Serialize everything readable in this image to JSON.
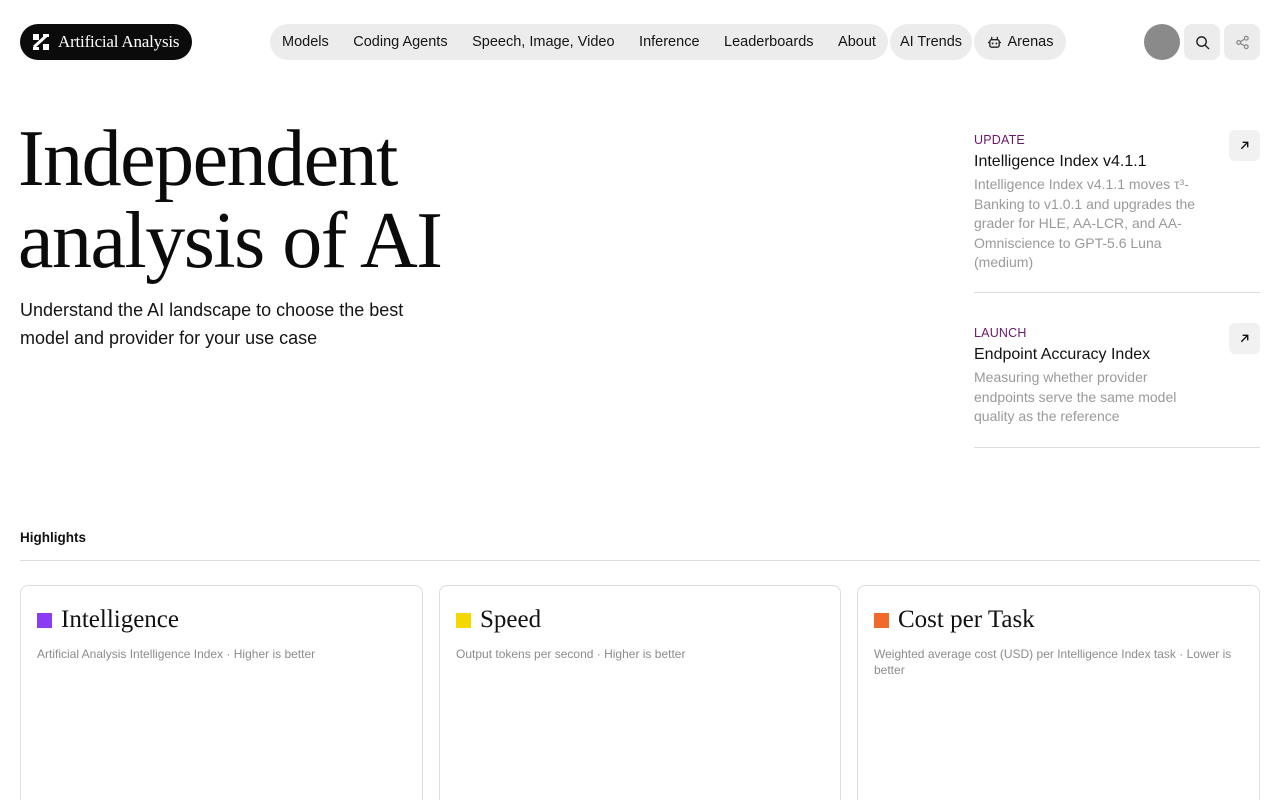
{
  "brand": {
    "name": "Artificial Analysis"
  },
  "nav": {
    "items": [
      "Models",
      "Coding Agents",
      "Speech, Image, Video",
      "Inference",
      "Leaderboards",
      "About"
    ],
    "trends": "AI Trends",
    "arenas": "Arenas"
  },
  "icons": {
    "search": "search-icon",
    "share": "share-icon",
    "arenas": "arena-icon",
    "arrow": "arrow-up-right-icon"
  },
  "hero": {
    "title_line1": "Independent",
    "title_line2": "analysis of AI",
    "subtitle": "Understand the AI landscape to choose the best model and provider for your use case"
  },
  "news": [
    {
      "tag": "UPDATE",
      "title": "Intelligence Index v4.1.1",
      "desc": "Intelligence Index v4.1.1 moves τ³-Banking to v1.0.1 and upgrades the grader for HLE, AA-LCR, and AA-Omniscience to GPT-5.6 Luna (medium)"
    },
    {
      "tag": "LAUNCH",
      "title": "Endpoint Accuracy Index",
      "desc": "Measuring whether provider endpoints serve the same model quality as the reference"
    }
  ],
  "highlights": {
    "label": "Highlights",
    "cards": [
      {
        "title": "Intelligence",
        "desc": "Artificial Analysis Intelligence Index · Higher is better",
        "color": "#8a3cf2"
      },
      {
        "title": "Speed",
        "desc": "Output tokens per second · Higher is better",
        "color": "#f5d800"
      },
      {
        "title": "Cost per Task",
        "desc": "Weighted average cost (USD) per Intelligence Index task · Lower is better",
        "color": "#f06a2a"
      }
    ]
  }
}
